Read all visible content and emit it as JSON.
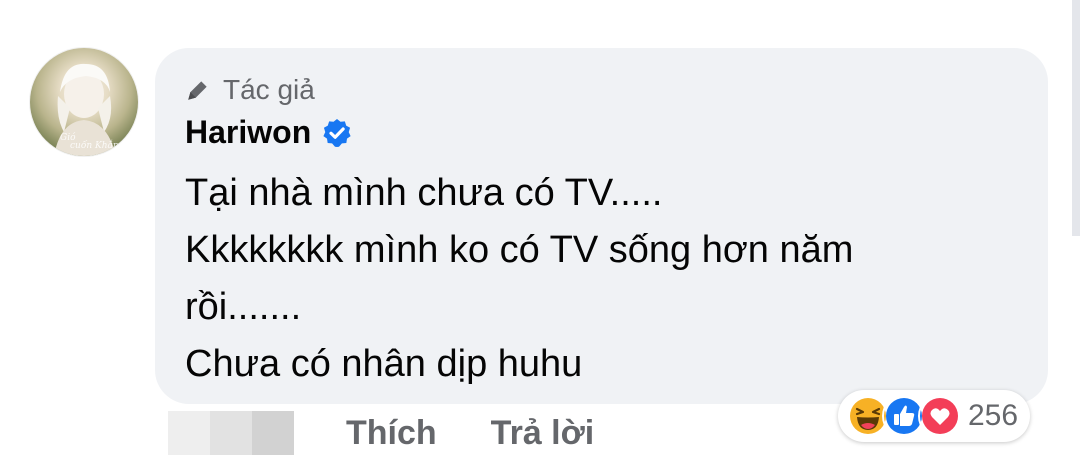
{
  "comment": {
    "author_badge": "Tác giả",
    "author_name": "Hariwon",
    "verified": true,
    "lines": [
      "Tại nhà mình chưa có TV.....",
      "Kkkkkkkk mình ko có TV sống hơn năm",
      "rồi.......",
      "Chưa có nhân dịp huhu"
    ]
  },
  "actions": {
    "like_label": "Thích",
    "reply_label": "Trả lời"
  },
  "reactions": {
    "types": [
      "haha-icon",
      "like-icon",
      "love-icon"
    ],
    "count": "256"
  },
  "colors": {
    "bubble_bg": "#f0f2f5",
    "text": "#050505",
    "secondary": "#65676b",
    "verified_blue": "#1877f2",
    "like_blue": "#1877f2",
    "love_red": "#f33e58",
    "haha_yellow": "#f7b125"
  }
}
